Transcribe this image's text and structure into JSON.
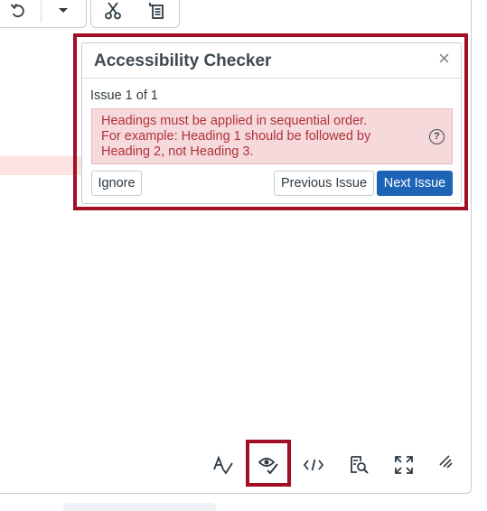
{
  "dialog": {
    "title": "Accessibility Checker",
    "close_glyph": "×",
    "issue_count": "Issue 1 of 1",
    "message_line1": "Headings must be applied in sequential order.",
    "message_line2": "For example: Heading 1 should be followed by",
    "message_line3": "Heading 2, not Heading 3.",
    "help_glyph": "?",
    "ignore_label": "Ignore",
    "previous_label": "Previous Issue",
    "next_label": "Next Issue"
  },
  "toolbar_top": {
    "icons": [
      "undo-icon",
      "chevron-down-icon",
      "cut-icon",
      "paste-icon"
    ]
  },
  "toolbar_bottom": {
    "icons": [
      "spellcheck-icon",
      "accessibility-checker-icon",
      "html-editor-icon",
      "find-icon",
      "fullscreen-icon",
      "resize-handle-icon"
    ]
  },
  "colors": {
    "annotation_red": "#a10f24",
    "primary_blue": "#1e64b6",
    "error_bg": "#f6d9db",
    "error_text": "#b0323d"
  }
}
